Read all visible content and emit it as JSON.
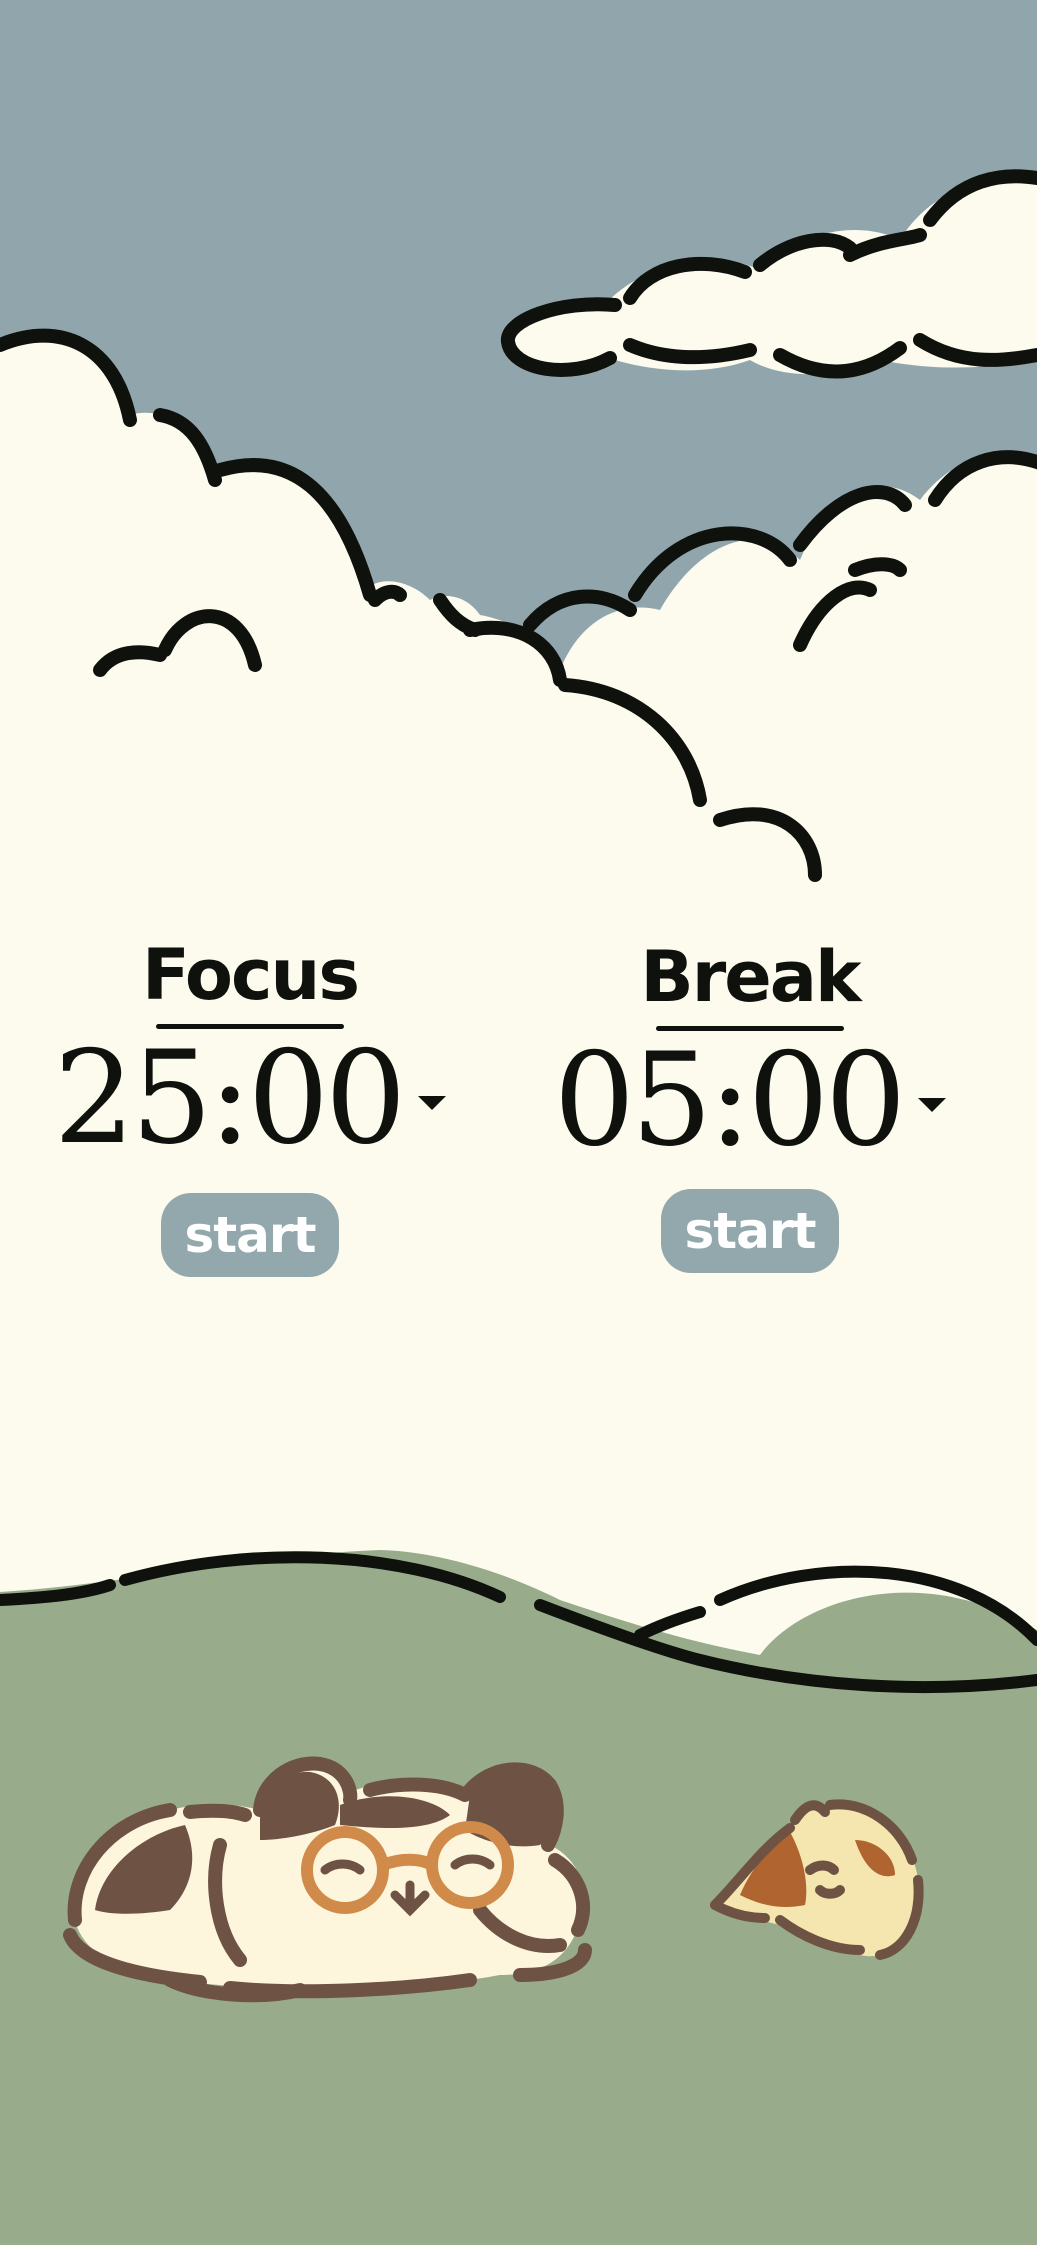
{
  "colors": {
    "sky": "#90a6ac",
    "cloud": "#fcfbee",
    "grass": "#98ac8c",
    "outline": "#0f110d",
    "button": "#93a8ad",
    "button_text": "#ffffff",
    "cat_brown": "#6e5244",
    "cat_cream": "#fdf5dc",
    "glasses": "#d08a4a",
    "kitten_orange": "#b0642f",
    "kitten_yellow": "#f5e5ae"
  },
  "focus_timer": {
    "title": "Focus",
    "time": "25:00",
    "start_label": "start"
  },
  "break_timer": {
    "title": "Break",
    "time": "05:00",
    "start_label": "start"
  },
  "illustration": {
    "icons": [
      "cloud-icon",
      "sleeping-cat-with-glasses-icon",
      "sleeping-kitten-icon",
      "hill-icon"
    ]
  }
}
